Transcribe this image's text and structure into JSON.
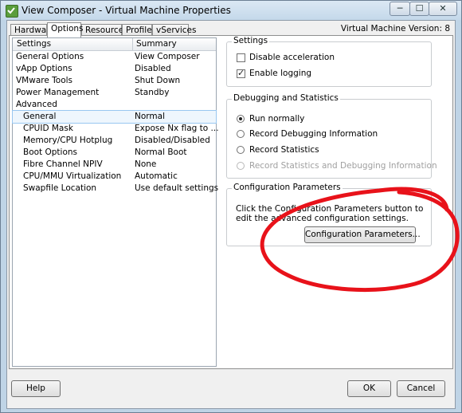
{
  "window": {
    "title": "View Composer - Virtual Machine Properties",
    "vm_version": "Virtual Machine Version: 8",
    "controls": {
      "minimize": "─",
      "maximize": "☐",
      "close": "✕"
    }
  },
  "tabs": [
    {
      "label": "Hardware"
    },
    {
      "label": "Options",
      "active": true
    },
    {
      "label": "Resources"
    },
    {
      "label": "Profiles"
    },
    {
      "label": "vServices"
    }
  ],
  "list": {
    "header": {
      "settings": "Settings",
      "summary": "Summary"
    },
    "rows": [
      {
        "setting": "General Options",
        "summary": "View Composer"
      },
      {
        "setting": "vApp Options",
        "summary": "Disabled"
      },
      {
        "setting": "VMware Tools",
        "summary": "Shut Down"
      },
      {
        "setting": "Power Management",
        "summary": "Standby"
      },
      {
        "setting": "Advanced",
        "summary": ""
      },
      {
        "setting": "General",
        "summary": "Normal",
        "indent": true,
        "selected": true
      },
      {
        "setting": "CPUID Mask",
        "summary": "Expose Nx flag to ...",
        "indent": true
      },
      {
        "setting": "Memory/CPU Hotplug",
        "summary": "Disabled/Disabled",
        "indent": true
      },
      {
        "setting": "Boot Options",
        "summary": "Normal Boot",
        "indent": true
      },
      {
        "setting": "Fibre Channel NPIV",
        "summary": "None",
        "indent": true
      },
      {
        "setting": "CPU/MMU Virtualization",
        "summary": "Automatic",
        "indent": true
      },
      {
        "setting": "Swapfile Location",
        "summary": "Use default settings",
        "indent": true
      }
    ]
  },
  "settings_group": {
    "legend": "Settings",
    "disable_acceleration": {
      "label": "Disable acceleration",
      "checked": false
    },
    "enable_logging": {
      "label": "Enable logging",
      "checked": true
    }
  },
  "debug_group": {
    "legend": "Debugging and Statistics",
    "options": [
      {
        "label": "Run normally",
        "selected": true
      },
      {
        "label": "Record Debugging Information",
        "selected": false
      },
      {
        "label": "Record Statistics",
        "selected": false
      },
      {
        "label": "Record Statistics and Debugging Information",
        "selected": false,
        "disabled": true
      }
    ]
  },
  "config_group": {
    "legend": "Configuration Parameters",
    "description": "Click the Configuration Parameters button to edit the advanced configuration settings.",
    "button_label": "Configuration Parameters..."
  },
  "footer": {
    "help": "Help",
    "ok": "OK",
    "cancel": "Cancel"
  },
  "annotation": {
    "color": "#e8121a"
  }
}
